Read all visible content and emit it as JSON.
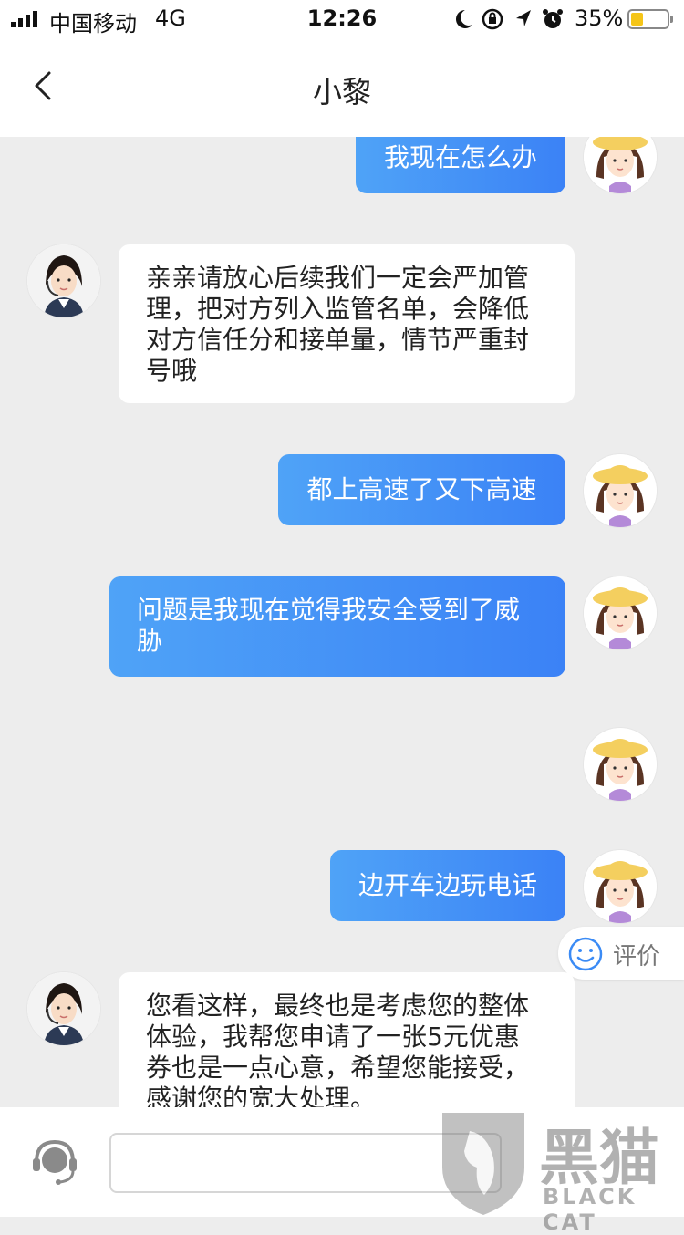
{
  "status_bar": {
    "carrier": "中国移动",
    "network": "4G",
    "time": "12:26",
    "battery": "35%",
    "battery_level": 0.35
  },
  "header": {
    "title": "小黎"
  },
  "messages": [
    {
      "side": "out",
      "text": "我现在怎么办"
    },
    {
      "side": "in",
      "lines": [
        "亲亲请放心后续我们一定会严加管",
        "理，把对方列入监管名单，会降低",
        "对方信任分和接单量，情节严重封",
        "号哦"
      ]
    },
    {
      "side": "out",
      "text": "都上高速了又下高速"
    },
    {
      "side": "out",
      "lines": [
        "问题是我现在觉得我安全受到了威",
        "胁"
      ]
    },
    {
      "side": "out",
      "text": ""
    },
    {
      "side": "out",
      "text": "边开车边玩电话"
    },
    {
      "side": "in",
      "lines": [
        "您看这样，最终也是考虑您的整体",
        "体验，我帮您申请了一张5元优惠",
        "券也是一点心意，希望您能接受，",
        "感谢您的宽大处理。"
      ]
    }
  ],
  "rate_button": {
    "label": "评价"
  },
  "input": {
    "placeholder": ""
  },
  "watermark": {
    "cn": "黑猫",
    "en": "BLACK CAT"
  },
  "colors": {
    "outgoing_bubble_start": "#4fa3f7",
    "outgoing_bubble_end": "#3b82f6",
    "incoming_bubble": "#ffffff",
    "background": "#ededed",
    "battery": "#f5c518"
  }
}
